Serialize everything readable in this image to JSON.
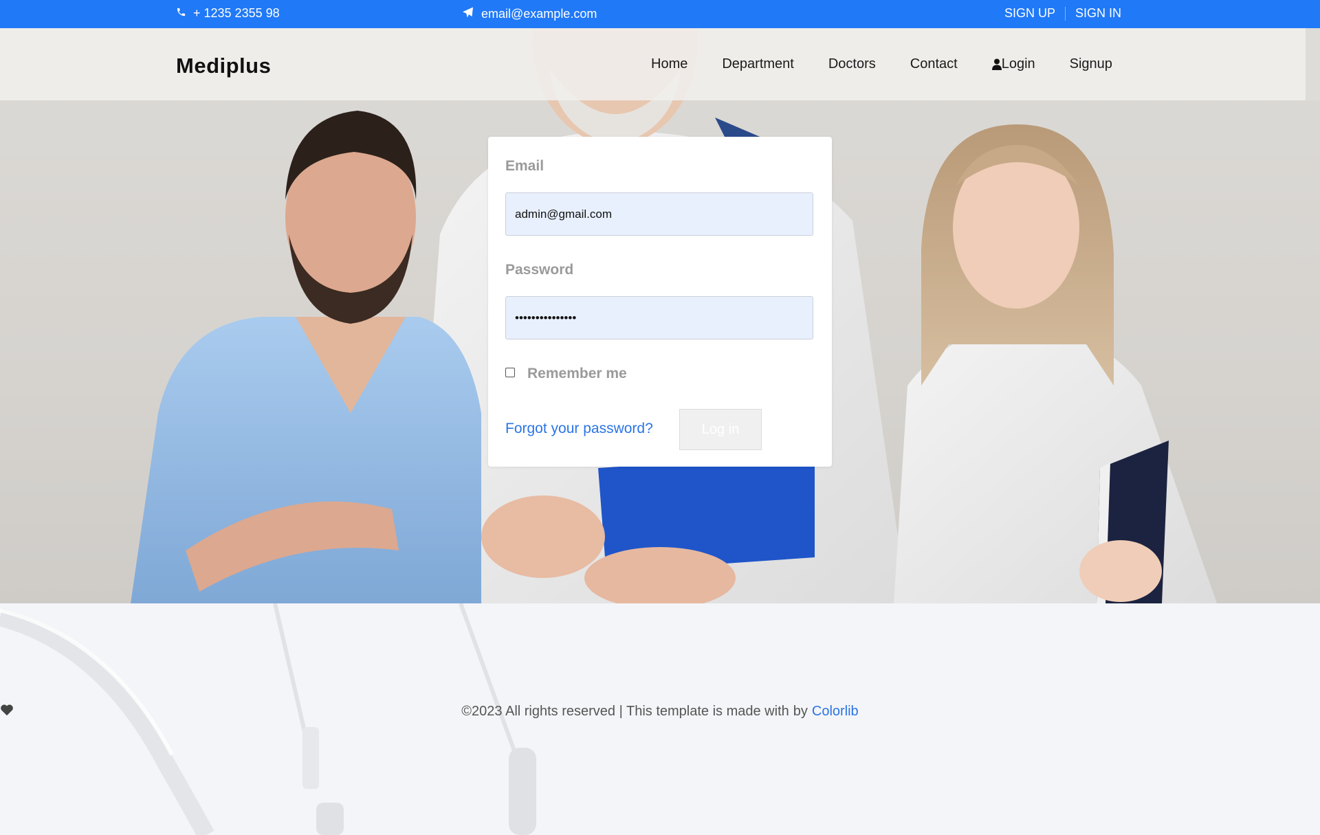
{
  "topbar": {
    "phone": "+ 1235 2355 98",
    "email": "email@example.com",
    "signup": "SIGN UP",
    "signin": "SIGN IN"
  },
  "header": {
    "brand": "Mediplus",
    "nav": [
      "Home",
      "Department",
      "Doctors",
      "Contact",
      "Login",
      "Signup"
    ]
  },
  "login": {
    "email_label": "Email",
    "email_value": "admin@gmail.com",
    "password_label": "Password",
    "password_value": "•••••••••••••••",
    "remember_label": "Remember me",
    "forgot_link": "Forgot your password?",
    "submit_label": "Log in"
  },
  "footer": {
    "copyright": "©2023 All rights reserved | This template is made with",
    "by": "by",
    "credit": "Colorlib"
  },
  "colors": {
    "accent": "#2079f7",
    "link": "#2a74e6",
    "input_bg": "#e8f0fe"
  },
  "icons": [
    "phone-icon",
    "paper-plane-icon",
    "user-icon",
    "heart-icon"
  ]
}
